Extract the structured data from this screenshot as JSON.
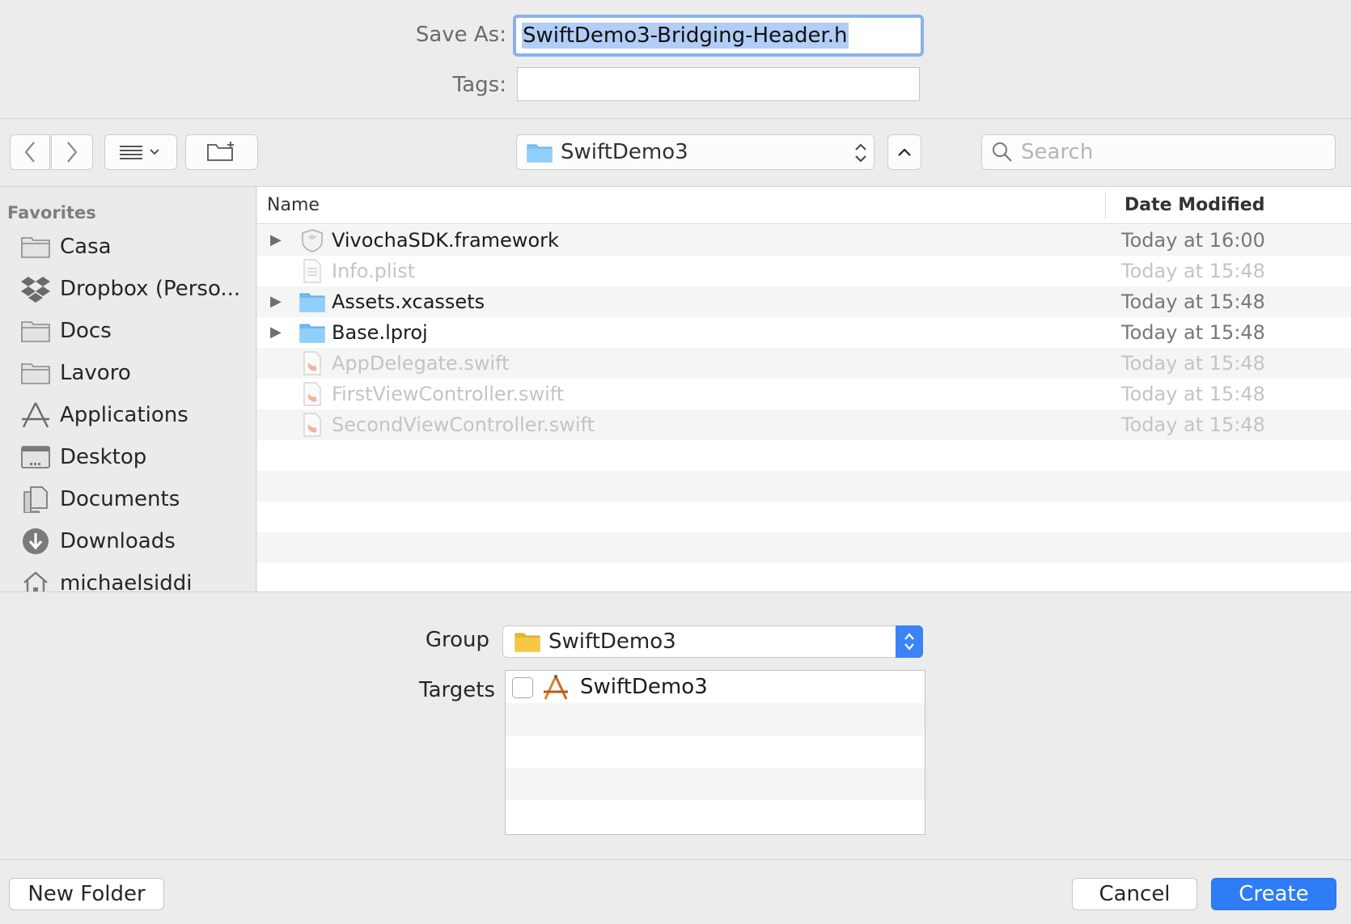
{
  "save_as": {
    "label": "Save As:",
    "value": "SwiftDemo3-Bridging-Header.h"
  },
  "tags": {
    "label": "Tags:",
    "value": ""
  },
  "toolbar": {
    "location": "SwiftDemo3",
    "search_placeholder": "Search"
  },
  "sidebar": {
    "heading": "Favorites",
    "items": [
      {
        "label": "Casa",
        "icon": "folder-icon"
      },
      {
        "label": "Dropbox (Perso...",
        "icon": "dropbox-icon"
      },
      {
        "label": "Docs",
        "icon": "folder-icon"
      },
      {
        "label": "Lavoro",
        "icon": "folder-icon"
      },
      {
        "label": "Applications",
        "icon": "applications-icon"
      },
      {
        "label": "Desktop",
        "icon": "desktop-icon"
      },
      {
        "label": "Documents",
        "icon": "documents-icon"
      },
      {
        "label": "Downloads",
        "icon": "downloads-icon"
      },
      {
        "label": "michaelsiddi",
        "icon": "home-icon"
      }
    ]
  },
  "file_list": {
    "columns": [
      "Name",
      "Date Modified"
    ],
    "rows": [
      {
        "name": "VivochaSDK.framework",
        "date": "Today at 16:00",
        "icon": "framework-icon",
        "expandable": true,
        "dimmed": false
      },
      {
        "name": "Info.plist",
        "date": "Today at 15:48",
        "icon": "plist-icon",
        "expandable": false,
        "dimmed": true
      },
      {
        "name": "Assets.xcassets",
        "date": "Today at 15:48",
        "icon": "folder-icon",
        "expandable": true,
        "dimmed": false
      },
      {
        "name": "Base.lproj",
        "date": "Today at 15:48",
        "icon": "folder-icon",
        "expandable": true,
        "dimmed": false
      },
      {
        "name": "AppDelegate.swift",
        "date": "Today at 15:48",
        "icon": "swift-file-icon",
        "expandable": false,
        "dimmed": true
      },
      {
        "name": "FirstViewController.swift",
        "date": "Today at 15:48",
        "icon": "swift-file-icon",
        "expandable": false,
        "dimmed": true
      },
      {
        "name": "SecondViewController.swift",
        "date": "Today at 15:48",
        "icon": "swift-file-icon",
        "expandable": false,
        "dimmed": true
      }
    ]
  },
  "group": {
    "label": "Group",
    "value": "SwiftDemo3"
  },
  "targets": {
    "label": "Targets",
    "items": [
      {
        "name": "SwiftDemo3",
        "checked": false
      }
    ]
  },
  "buttons": {
    "new_folder": "New Folder",
    "cancel": "Cancel",
    "create": "Create"
  },
  "colors": {
    "accent": "#2e7cf6",
    "selection": "#b2cdf6",
    "folder_blue": "#7cc4f5",
    "folder_yellow": "#f5c842"
  }
}
